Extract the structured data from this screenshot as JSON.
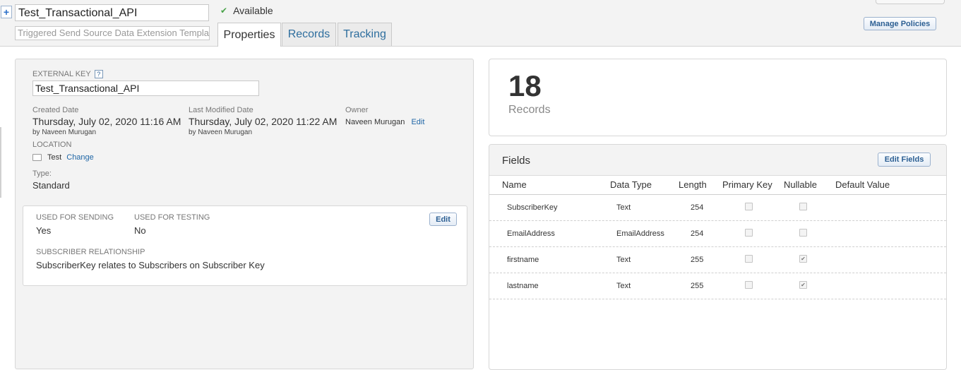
{
  "header": {
    "name": "Test_Transactional_API",
    "description_placeholder": "Triggered Send Source Data Extension Template",
    "status": "Available",
    "tabs": [
      {
        "label": "Properties"
      },
      {
        "label": "Records"
      },
      {
        "label": "Tracking"
      }
    ],
    "manage_policies": "Manage Policies"
  },
  "properties": {
    "external_key_label": "EXTERNAL KEY",
    "help": "?",
    "external_key": "Test_Transactional_API",
    "created_label": "Created Date",
    "created_value": "Thursday, July 02, 2020 11:16 AM",
    "created_by": "by Naveen Murugan",
    "modified_label": "Last Modified Date",
    "modified_value": "Thursday, July 02, 2020 11:22 AM",
    "modified_by": "by Naveen Murugan",
    "owner_label": "Owner",
    "owner_value": "Naveen Murugan",
    "owner_edit": "Edit",
    "location_label": "LOCATION",
    "location_value": "Test",
    "location_change": "Change",
    "type_label": "Type:",
    "type_value": "Standard"
  },
  "sending": {
    "used_for_sending_label": "USED FOR SENDING",
    "used_for_sending_value": "Yes",
    "used_for_testing_label": "USED FOR TESTING",
    "used_for_testing_value": "No",
    "edit": "Edit",
    "relationship_label": "SUBSCRIBER RELATIONSHIP",
    "relationship_value": "SubscriberKey relates to Subscribers on Subscriber Key"
  },
  "records": {
    "count": "18",
    "label": "Records"
  },
  "fields": {
    "title": "Fields",
    "edit_fields": "Edit Fields",
    "columns": [
      "Name",
      "Data Type",
      "Length",
      "Primary Key",
      "Nullable",
      "Default Value"
    ],
    "rows": [
      {
        "name": "SubscriberKey",
        "type": "Text",
        "length": "254",
        "primary": false,
        "nullable": false
      },
      {
        "name": "EmailAddress",
        "type": "EmailAddress",
        "length": "254",
        "primary": false,
        "nullable": false
      },
      {
        "name": "firstname",
        "type": "Text",
        "length": "255",
        "primary": false,
        "nullable": true
      },
      {
        "name": "lastname",
        "type": "Text",
        "length": "255",
        "primary": false,
        "nullable": true
      }
    ]
  }
}
